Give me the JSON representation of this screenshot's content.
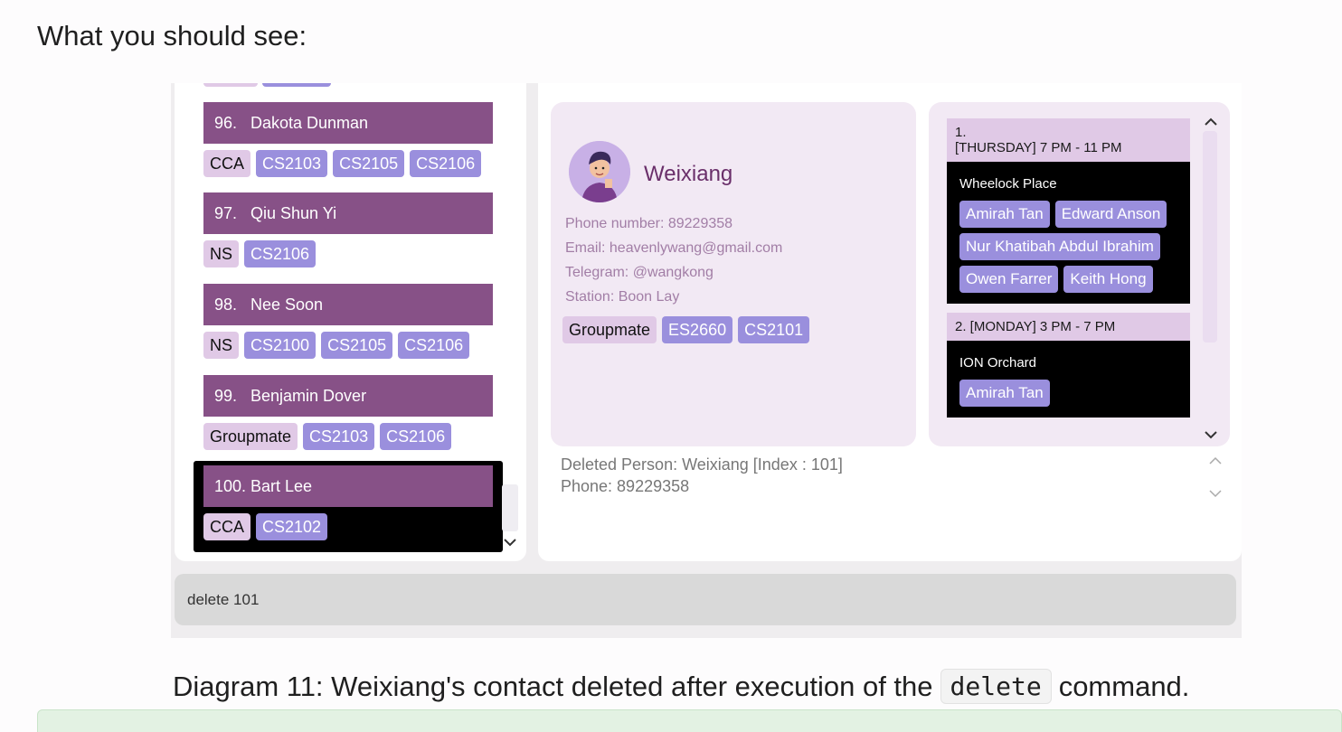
{
  "heading": "What you should see:",
  "list": {
    "rows": [
      {
        "index": "96.",
        "name": "Dakota Dunman",
        "tags": [
          {
            "label": "CCA",
            "kind": "grp"
          },
          {
            "label": "CS2103",
            "kind": "mod"
          },
          {
            "label": "CS2105",
            "kind": "mod"
          },
          {
            "label": "CS2106",
            "kind": "mod"
          }
        ]
      },
      {
        "index": "97.",
        "name": "Qiu Shun Yi",
        "tags": [
          {
            "label": "NS",
            "kind": "grp"
          },
          {
            "label": "CS2106",
            "kind": "mod"
          }
        ]
      },
      {
        "index": "98.",
        "name": "Nee Soon",
        "tags": [
          {
            "label": "NS",
            "kind": "grp"
          },
          {
            "label": "CS2100",
            "kind": "mod"
          },
          {
            "label": "CS2105",
            "kind": "mod"
          },
          {
            "label": "CS2106",
            "kind": "mod"
          }
        ]
      },
      {
        "index": "99.",
        "name": "Benjamin Dover",
        "tags": [
          {
            "label": "Groupmate",
            "kind": "grp"
          },
          {
            "label": "CS2103",
            "kind": "mod"
          },
          {
            "label": "CS2106",
            "kind": "mod"
          }
        ]
      },
      {
        "index": "100.",
        "name": "Bart Lee",
        "tags": [
          {
            "label": "CCA",
            "kind": "grp"
          },
          {
            "label": "CS2102",
            "kind": "mod"
          }
        ]
      }
    ]
  },
  "person": {
    "name": "Weixiang",
    "phone": "Phone number: 89229358",
    "email": "Email: heavenlywang@gmail.com",
    "telegram": "Telegram: @wangkong",
    "station": "Station: Boon Lay",
    "tags": [
      {
        "label": "Groupmate",
        "kind": "grp"
      },
      {
        "label": "ES2660",
        "kind": "mod"
      },
      {
        "label": "CS2101",
        "kind": "mod"
      }
    ]
  },
  "meetings": [
    {
      "header_line1": "1.",
      "header_line2": "[THURSDAY] 7 PM - 11 PM",
      "location": "Wheelock Place",
      "people": [
        "Amirah Tan",
        "Edward Anson",
        "Nur Khatibah Abdul Ibrahim",
        "Owen Farrer",
        "Keith Hong"
      ]
    },
    {
      "header_line1": "2. [MONDAY] 3 PM - 7 PM",
      "header_line2": "",
      "location": "ION Orchard",
      "people": [
        "Amirah Tan"
      ]
    }
  ],
  "result": {
    "line1": "Deleted Person: Weixiang [Index : 101]",
    "line2": "Phone: 89229358"
  },
  "command": {
    "value": "delete 101"
  },
  "caption": {
    "before": "Diagram 11: Weixiang's contact deleted after execution of the",
    "code": "delete",
    "after": "command."
  },
  "icons": {
    "chevron_up": "chevron-up-icon",
    "chevron_down": "chevron-down-icon"
  }
}
